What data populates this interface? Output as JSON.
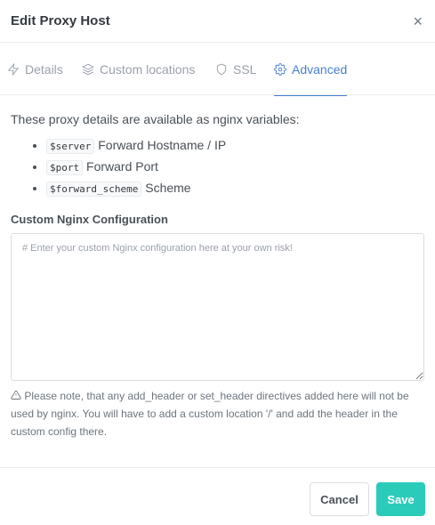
{
  "modal": {
    "title": "Edit Proxy Host",
    "close_icon": "×"
  },
  "tabs": [
    {
      "label": "Details",
      "icon": "bolt-icon"
    },
    {
      "label": "Custom locations",
      "icon": "layers-icon"
    },
    {
      "label": "SSL",
      "icon": "shield-icon"
    },
    {
      "label": "Advanced",
      "icon": "gear-icon",
      "active": true
    }
  ],
  "advanced": {
    "intro": "These proxy details are available as nginx variables:",
    "variables": [
      {
        "code": "$server",
        "desc": "Forward Hostname / IP"
      },
      {
        "code": "$port",
        "desc": "Forward Port"
      },
      {
        "code": "$forward_scheme",
        "desc": "Scheme"
      }
    ],
    "config_label": "Custom Nginx Configuration",
    "config_placeholder": "# Enter your custom Nginx configuration here at your own risk!",
    "config_value": "",
    "note": "Please note, that any add_header or set_header directives added here will not be used by nginx. You will have to add a custom location '/' and add the header in the custom config there."
  },
  "footer": {
    "cancel_label": "Cancel",
    "save_label": "Save"
  },
  "colors": {
    "accent": "#467fcf",
    "save": "#2bcbba"
  }
}
